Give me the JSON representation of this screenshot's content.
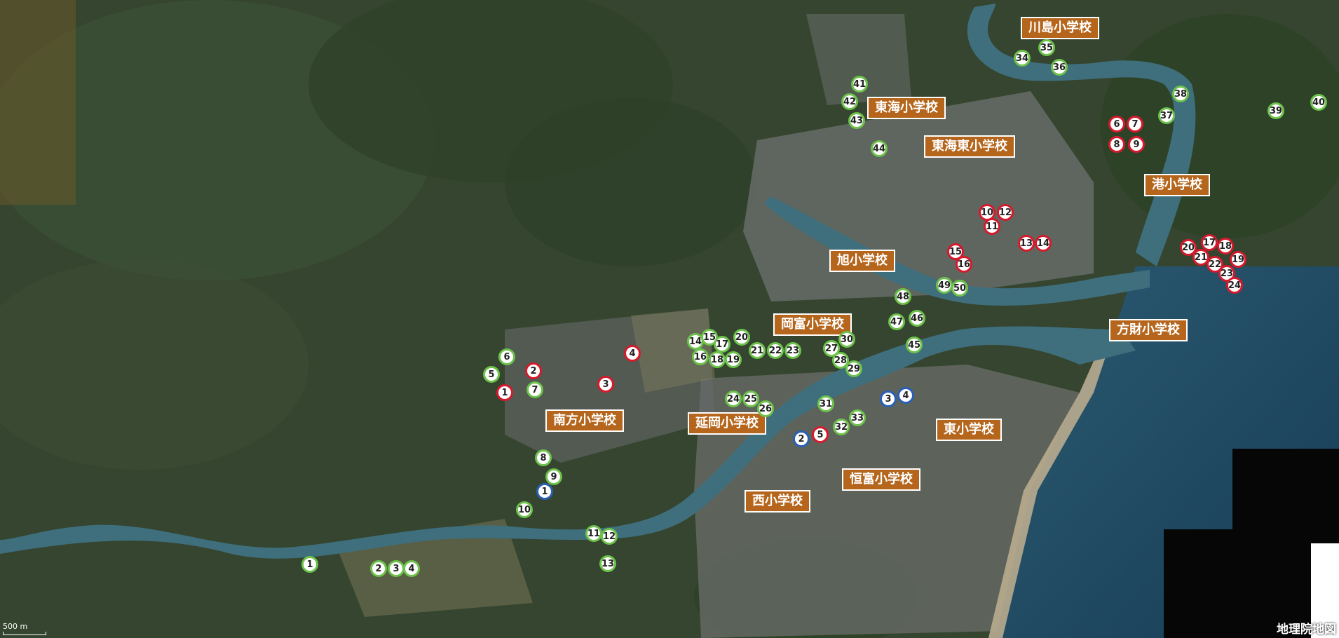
{
  "map": {
    "attribution": "地理院地図",
    "scale": "500 m"
  },
  "schools": [
    {
      "id": "kawashima",
      "name": "川島小学校"
    },
    {
      "id": "tokai",
      "name": "東海小学校"
    },
    {
      "id": "tokai-higashi",
      "name": "東海東小学校"
    },
    {
      "id": "minato",
      "name": "港小学校"
    },
    {
      "id": "asahi",
      "name": "旭小学校"
    },
    {
      "id": "okatomi",
      "name": "岡富小学校"
    },
    {
      "id": "hozai",
      "name": "方財小学校"
    },
    {
      "id": "minamikata",
      "name": "南方小学校"
    },
    {
      "id": "nobeoka",
      "name": "延岡小学校"
    },
    {
      "id": "higashi",
      "name": "東小学校"
    },
    {
      "id": "tsunetomi",
      "name": "恒富小学校"
    },
    {
      "id": "nishi",
      "name": "西小学校"
    }
  ],
  "markers": {
    "green": [
      "1",
      "2",
      "3",
      "4",
      "5",
      "6",
      "7",
      "8",
      "9",
      "10",
      "11",
      "12",
      "13",
      "14",
      "15",
      "16",
      "17",
      "18",
      "19",
      "20",
      "21",
      "22",
      "23",
      "24",
      "25",
      "26",
      "27",
      "28",
      "29",
      "30",
      "31",
      "32",
      "33",
      "34",
      "35",
      "36",
      "37",
      "38",
      "39",
      "40",
      "41",
      "42",
      "43",
      "44",
      "45",
      "46",
      "47",
      "48",
      "49",
      "50"
    ],
    "red": [
      "1",
      "2",
      "3",
      "4",
      "5",
      "6",
      "7",
      "8",
      "9",
      "10",
      "11",
      "12",
      "13",
      "14",
      "15",
      "16",
      "17",
      "18",
      "19",
      "20",
      "21",
      "22",
      "23",
      "24"
    ],
    "blue": [
      "1",
      "2",
      "3",
      "4"
    ]
  },
  "colors": {
    "green": "#6cc24a",
    "red": "#d7192c",
    "blue": "#2a5fb5",
    "label_bg": "#b5661c",
    "sea": "#1f4f6a",
    "river": "#3f6f7d"
  }
}
